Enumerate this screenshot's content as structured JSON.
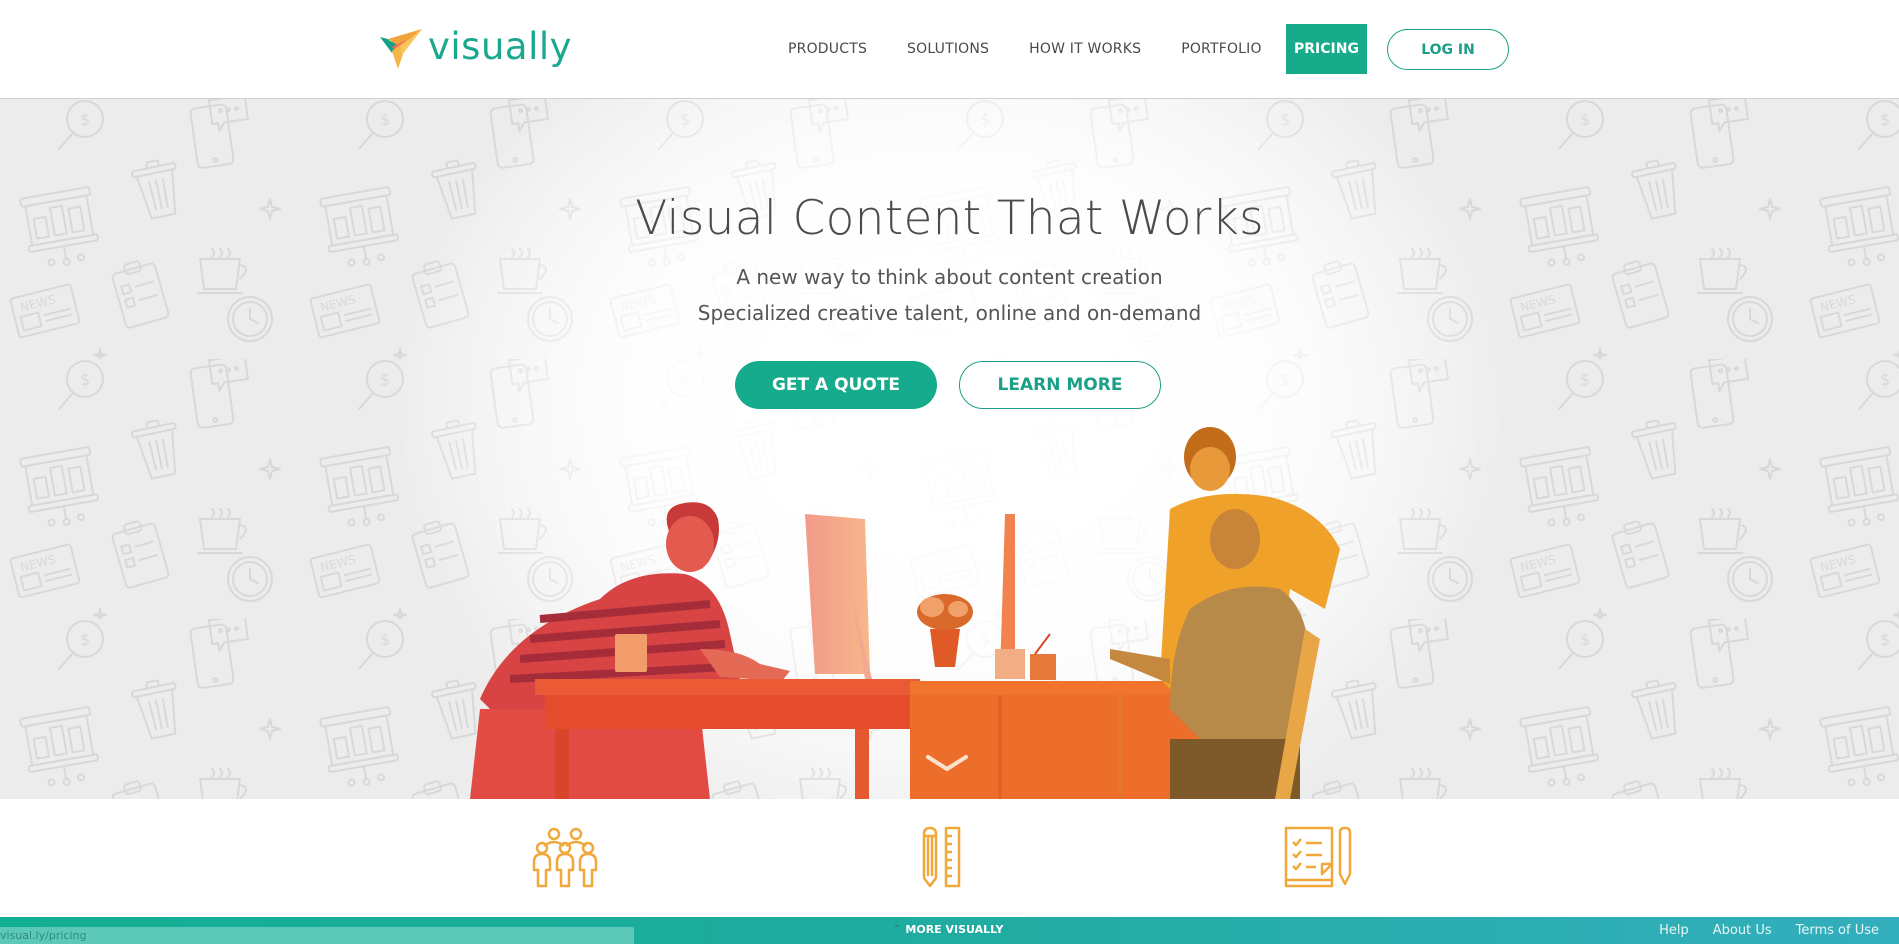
{
  "header": {
    "logo_text": "visually",
    "nav": [
      {
        "label": "PRODUCTS"
      },
      {
        "label": "SOLUTIONS"
      },
      {
        "label": "HOW IT WORKS"
      },
      {
        "label": "PORTFOLIO"
      }
    ],
    "pricing_label": "PRICING",
    "login_label": "LOG IN"
  },
  "hero": {
    "title": "Visual Content That Works",
    "subtitle_line1": "A new way to think about content creation",
    "subtitle_line2": "Specialized creative talent, online and on-demand",
    "cta_primary": "GET A QUOTE",
    "cta_secondary": "LEARN MORE",
    "scroll_icon": "chevron-down-icon"
  },
  "features": {
    "icons": [
      "people-group-icon",
      "pencil-ruler-icon",
      "checklist-pen-icon"
    ]
  },
  "footer": {
    "status_url": "visual.ly/pricing",
    "more_label": "MORE VISUALLY",
    "links": [
      {
        "label": "Help"
      },
      {
        "label": "About Us"
      },
      {
        "label": "Terms of Use"
      }
    ]
  },
  "colors": {
    "brand_green": "#17ab8a",
    "accent_orange": "#f0a83a",
    "text_dark": "#4b4b4b"
  }
}
